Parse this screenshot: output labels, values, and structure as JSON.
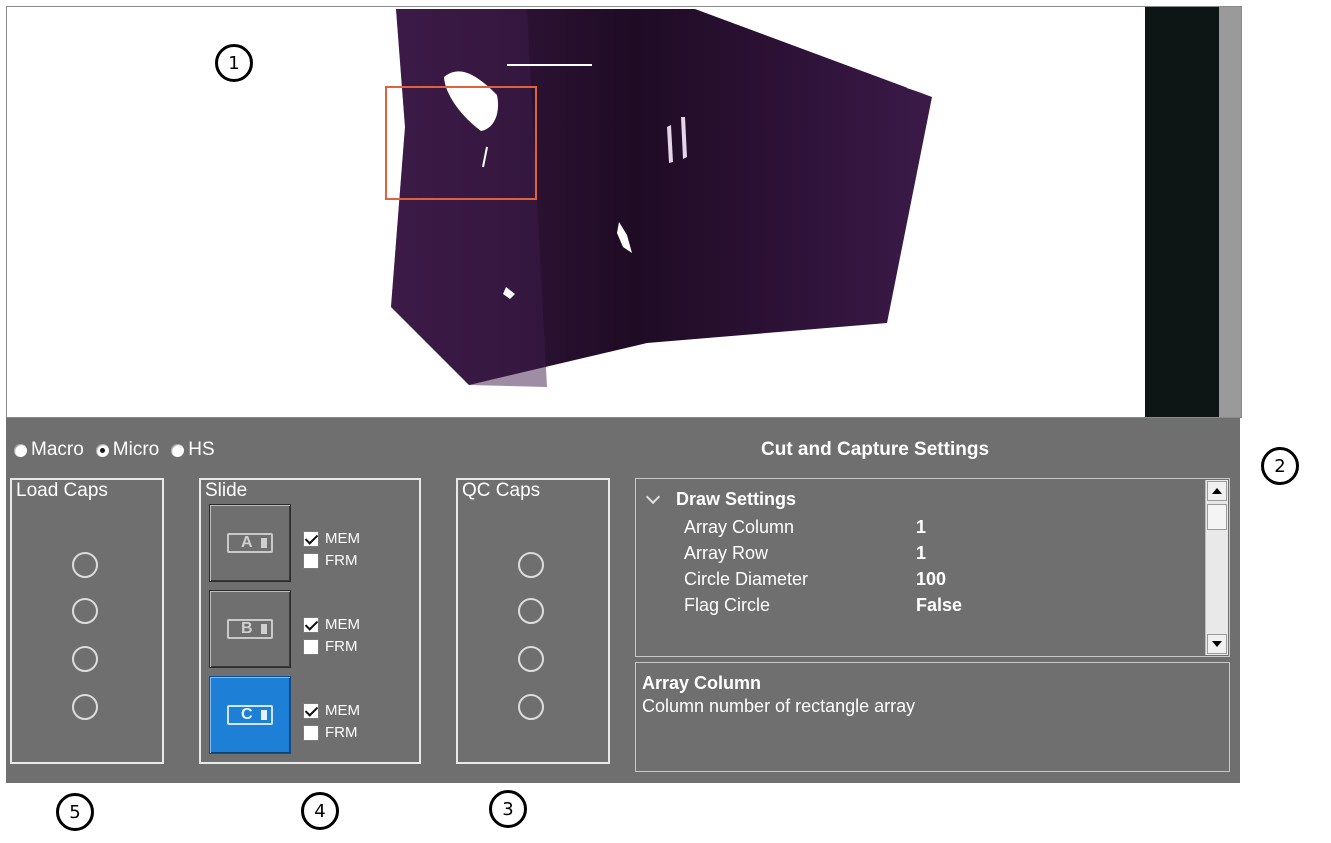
{
  "viewer": {
    "roi_color": "#e0623a",
    "tissue_color": "#2b1230"
  },
  "modes": [
    {
      "label": "Macro",
      "selected": false
    },
    {
      "label": "Micro",
      "selected": true
    },
    {
      "label": "HS",
      "selected": false
    }
  ],
  "settings_title": "Cut and Capture Settings",
  "load_caps": {
    "title": "Load Caps",
    "count": 4
  },
  "slide": {
    "title": "Slide",
    "items": [
      {
        "letter": "A",
        "active": false,
        "mem_label": "MEM",
        "mem_checked": true,
        "frm_label": "FRM",
        "frm_checked": false
      },
      {
        "letter": "B",
        "active": false,
        "mem_label": "MEM",
        "mem_checked": true,
        "frm_label": "FRM",
        "frm_checked": false
      },
      {
        "letter": "C",
        "active": true,
        "mem_label": "MEM",
        "mem_checked": true,
        "frm_label": "FRM",
        "frm_checked": false
      }
    ]
  },
  "qc_caps": {
    "title": "QC Caps",
    "count": 4
  },
  "property_grid": {
    "category": "Draw Settings",
    "rows": [
      {
        "name": "Array Column",
        "value": "1"
      },
      {
        "name": "Array Row",
        "value": "1"
      },
      {
        "name": "Circle Diameter",
        "value": "100"
      },
      {
        "name": "Flag Circle",
        "value": "False"
      }
    ]
  },
  "description": {
    "title": "Array Column",
    "text": "Column number of rectangle array"
  },
  "callouts": [
    "1",
    "2",
    "3",
    "4",
    "5"
  ],
  "colors": {
    "panel": "#6f6f6f",
    "active_slide": "#1d7fd6"
  }
}
